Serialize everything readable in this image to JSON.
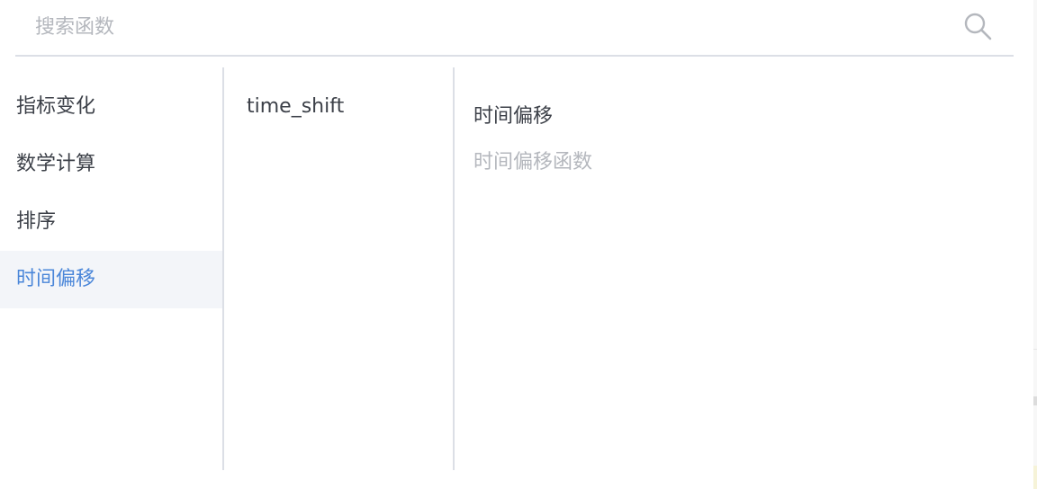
{
  "search": {
    "placeholder": "搜索函数",
    "value": "",
    "icon": "search-icon"
  },
  "categories": [
    {
      "label": "指标变化",
      "active": false
    },
    {
      "label": "数学计算",
      "active": false
    },
    {
      "label": "排序",
      "active": false
    },
    {
      "label": "时间偏移",
      "active": true
    }
  ],
  "functions": [
    {
      "label": "time_shift"
    }
  ],
  "detail": {
    "title": "时间偏移",
    "description": "时间偏移函数"
  },
  "colors": {
    "accent": "#4a86d9",
    "active_background": "#f3f5f9",
    "text": "#3c4048",
    "muted_text": "#b4b7bd",
    "divider": "#dcdfe6"
  }
}
